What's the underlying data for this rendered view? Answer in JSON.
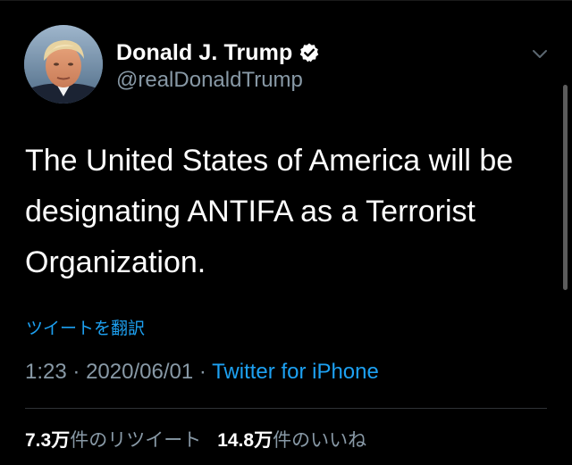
{
  "author": {
    "display_name": "Donald J. Trump",
    "handle": "@realDonaldTrump",
    "verified": true,
    "avatar_icon": "profile-photo"
  },
  "tweet": {
    "text": "The United States of America will be designating ANTIFA as a Terrorist Organization.",
    "translate_label": "ツイートを翻訳"
  },
  "meta": {
    "time": "1:23",
    "separator": "·",
    "date": "2020/06/01",
    "source": "Twitter for iPhone"
  },
  "stats": {
    "retweets_count": "7.3万",
    "retweets_label": "件のリツイート",
    "likes_count": "14.8万",
    "likes_label": "件のいいね"
  },
  "icons": {
    "verified": "verified-badge-icon",
    "menu": "chevron-down-icon"
  },
  "colors": {
    "background": "#000000",
    "text_primary": "#ffffff",
    "text_secondary": "#8899a6",
    "link": "#1da1f2",
    "divider": "#2f3336"
  }
}
